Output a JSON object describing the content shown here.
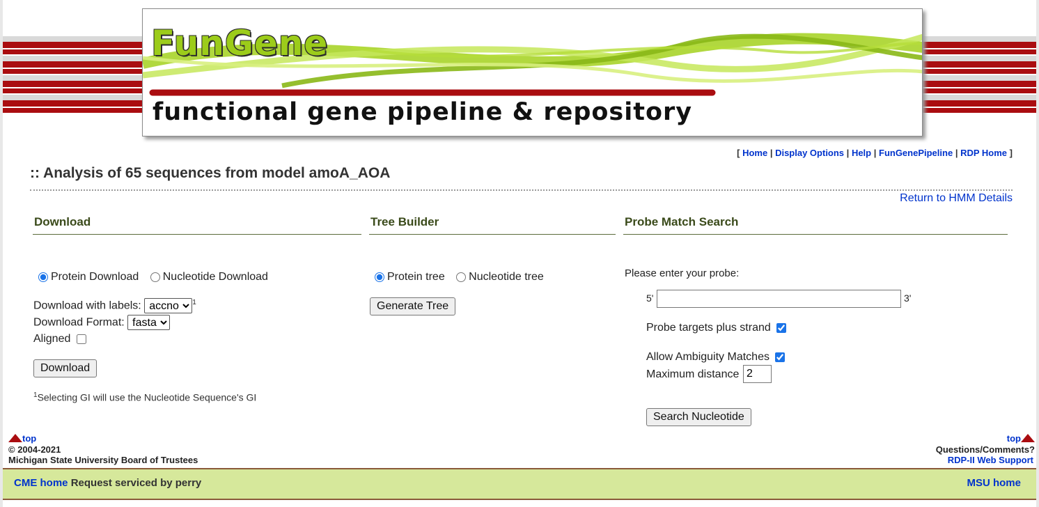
{
  "banner": {
    "logo_text": "FunGene",
    "tagline": "functional gene pipeline & repository"
  },
  "nav": {
    "open": "[",
    "sep": "|",
    "close": "]",
    "items": [
      "Home",
      "Display Options",
      "Help",
      "FunGenePipeline",
      "RDP Home"
    ]
  },
  "page_title": ":: Analysis of 65 sequences from model amoA_AOA",
  "return_link": "Return to HMM Details",
  "download": {
    "heading": "Download",
    "radio_protein": "Protein Download",
    "radio_nucleotide": "Nucleotide Download",
    "selected": "protein",
    "labels_label": "Download with labels:",
    "labels_value": "accno",
    "labels_sup": "1",
    "format_label": "Download Format:",
    "format_value": "fasta",
    "aligned_label": "Aligned",
    "aligned_checked": false,
    "button": "Download",
    "footnote_sup": "1",
    "footnote": "Selecting GI will use the Nucleotide Sequence's GI"
  },
  "tree": {
    "heading": "Tree Builder",
    "radio_protein": "Protein tree",
    "radio_nucleotide": "Nucleotide tree",
    "selected": "protein",
    "button": "Generate Tree"
  },
  "probe": {
    "heading": "Probe Match Search",
    "prompt": "Please enter your probe:",
    "five_prime": "5'",
    "three_prime": "3'",
    "probe_value": "",
    "plus_strand_label": "Probe targets plus strand",
    "plus_strand_checked": true,
    "ambiguity_label": "Allow Ambiguity Matches",
    "ambiguity_checked": true,
    "max_distance_label": "Maximum distance",
    "max_distance_value": "2",
    "button": "Search Nucleotide"
  },
  "footer": {
    "top_left": "top",
    "top_right": "top",
    "copyright": "© 2004-2021",
    "owner": "Michigan State University Board of Trustees",
    "questions": "Questions/Comments?",
    "support_link": "RDP-II Web Support",
    "cme_home": "CME home",
    "serviced": "Request serviced by perry",
    "msu_home": "MSU home"
  },
  "colors": {
    "stripe_red": "#aa0d10",
    "link_blue": "#0033cc",
    "logo_green": "#9ccc1a",
    "footer_green": "#d6e89b"
  }
}
